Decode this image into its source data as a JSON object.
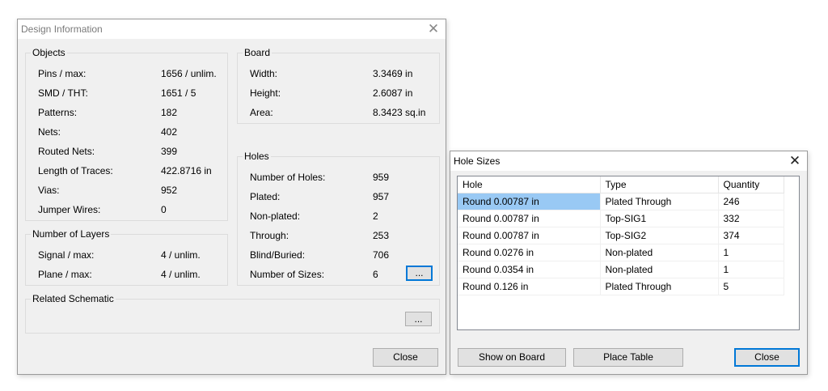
{
  "design_dialog": {
    "title": "Design Information",
    "objects": {
      "label": "Objects",
      "rows": [
        {
          "label": "Pins / max:",
          "value": "1656 / unlim."
        },
        {
          "label": "SMD / THT:",
          "value": "1651 / 5"
        },
        {
          "label": "Patterns:",
          "value": "182"
        },
        {
          "label": "Nets:",
          "value": "402"
        },
        {
          "label": "Routed Nets:",
          "value": "399"
        },
        {
          "label": "Length of Traces:",
          "value": "422.8716 in"
        },
        {
          "label": "Vias:",
          "value": "952"
        },
        {
          "label": "Jumper Wires:",
          "value": "0"
        }
      ]
    },
    "layers": {
      "label": "Number of Layers",
      "rows": [
        {
          "label": "Signal / max:",
          "value": "4 / unlim."
        },
        {
          "label": "Plane / max:",
          "value": "4 / unlim."
        }
      ]
    },
    "board": {
      "label": "Board",
      "rows": [
        {
          "label": "Width:",
          "value": "3.3469 in"
        },
        {
          "label": "Height:",
          "value": "2.6087 in"
        },
        {
          "label": "Area:",
          "value": "8.3423 sq.in"
        }
      ]
    },
    "holes": {
      "label": "Holes",
      "rows": [
        {
          "label": "Number of Holes:",
          "value": "959"
        },
        {
          "label": "Plated:",
          "value": "957"
        },
        {
          "label": "Non-plated:",
          "value": "2"
        },
        {
          "label": "Through:",
          "value": "253"
        },
        {
          "label": "Blind/Buried:",
          "value": "706"
        },
        {
          "label": "Number of Sizes:",
          "value": "6"
        }
      ],
      "sizes_button": "..."
    },
    "schematic": {
      "label": "Related Schematic",
      "browse_button": "..."
    },
    "close_button": "Close"
  },
  "hole_dialog": {
    "title": "Hole Sizes",
    "columns": [
      "Hole",
      "Type",
      "Quantity"
    ],
    "rows": [
      [
        "Round 0.00787 in",
        "Plated Through",
        "246"
      ],
      [
        "Round 0.00787 in",
        "Top-SIG1",
        "332"
      ],
      [
        "Round 0.00787 in",
        "Top-SIG2",
        "374"
      ],
      [
        "Round 0.0276 in",
        "Non-plated",
        "1"
      ],
      [
        "Round 0.0354 in",
        "Non-plated",
        "1"
      ],
      [
        "Round 0.126 in",
        "Plated Through",
        "5"
      ]
    ],
    "show_button": "Show on Board",
    "place_button": "Place Table",
    "close_button": "Close"
  },
  "icons": {
    "close": "close-icon"
  },
  "colors": {
    "selection": "#99c9f4",
    "default_button_border": "#0078d7"
  }
}
